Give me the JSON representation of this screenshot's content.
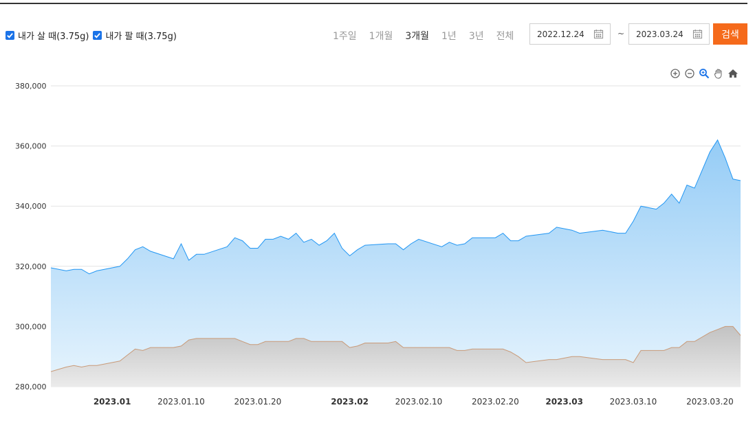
{
  "legend": {
    "buy_label": "내가 살 때(3.75g)",
    "sell_label": "내가 팔 때(3.75g)"
  },
  "periods": [
    {
      "label": "1주일",
      "active": false
    },
    {
      "label": "1개월",
      "active": false
    },
    {
      "label": "3개월",
      "active": true
    },
    {
      "label": "1년",
      "active": false
    },
    {
      "label": "3년",
      "active": false
    },
    {
      "label": "전체",
      "active": false
    }
  ],
  "date_range": {
    "start": "2022.12.24",
    "separator": "~",
    "end": "2023.03.24"
  },
  "search_label": "검색",
  "icons": [
    "zoom-in-icon",
    "zoom-out-icon",
    "selection-zoom-icon",
    "pan-hand-icon",
    "reset-home-icon"
  ],
  "colors": {
    "buy_line": "#2196f3",
    "buy_fill": "#a9d6f9",
    "sell_line": "#c99a78",
    "sell_fill": "#cfcfcf",
    "search_button": "#f56a1b",
    "checkbox": "#1a73e8"
  },
  "chart_data": {
    "type": "area",
    "x": [
      "2022.12.24",
      "2022.12.26",
      "2022.12.27",
      "2022.12.28",
      "2022.12.29",
      "2022.12.30",
      "2023.01.02",
      "2023.01.03",
      "2023.01.04",
      "2023.01.05",
      "2023.01.06",
      "2023.01.09",
      "2023.01.10",
      "2023.01.11",
      "2023.01.12",
      "2023.01.13",
      "2023.01.16",
      "2023.01.17",
      "2023.01.18",
      "2023.01.19",
      "2023.01.20",
      "2023.01.21",
      "2023.01.22",
      "2023.01.23",
      "2023.01.24",
      "2023.01.25",
      "2023.01.26",
      "2023.01.27",
      "2023.01.28",
      "2023.01.29",
      "2023.01.30",
      "2023.01.31",
      "2023.02.01",
      "2023.02.02",
      "2023.02.03",
      "2023.02.06",
      "2023.02.07",
      "2023.02.08",
      "2023.02.09",
      "2023.02.10",
      "2023.02.13",
      "2023.02.14",
      "2023.02.15",
      "2023.02.16",
      "2023.02.17",
      "2023.02.20",
      "2023.02.21",
      "2023.02.22",
      "2023.02.23",
      "2023.02.24",
      "2023.02.27",
      "2023.02.28",
      "2023.03.02",
      "2023.03.03",
      "2023.03.06",
      "2023.03.07",
      "2023.03.08",
      "2023.03.09",
      "2023.03.10",
      "2023.03.11",
      "2023.03.13",
      "2023.03.14",
      "2023.03.15",
      "2023.03.16",
      "2023.03.17",
      "2023.03.18",
      "2023.03.20",
      "2023.03.21",
      "2023.03.22",
      "2023.03.23",
      "2023.03.24"
    ],
    "series": [
      {
        "name": "내가 살 때(3.75g)",
        "values": [
          319500,
          318500,
          319000,
          319000,
          317500,
          318500,
          320000,
          322500,
          325500,
          326500,
          325000,
          322500,
          327500,
          322000,
          324000,
          324000,
          326500,
          329500,
          328500,
          326000,
          326000,
          329000,
          329000,
          330000,
          329000,
          331000,
          328000,
          329000,
          327000,
          328500,
          331000,
          326000,
          323500,
          325500,
          327000,
          327500,
          327500,
          325500,
          327500,
          329000,
          326500,
          328000,
          327000,
          327500,
          329500,
          329500,
          331000,
          328500,
          328500,
          330000,
          331000,
          333000,
          332000,
          331000,
          332000,
          331500,
          331000,
          331000,
          335000,
          340000,
          339000,
          341000,
          344000,
          341000,
          347000,
          346000,
          358000,
          362000,
          356000,
          349000,
          348500
        ]
      },
      {
        "name": "내가 팔 때(3.75g)",
        "values": [
          285000,
          286500,
          287000,
          286500,
          287000,
          287000,
          288500,
          290500,
          292500,
          292000,
          293000,
          293000,
          293500,
          295500,
          296000,
          296000,
          296000,
          296000,
          295000,
          294000,
          294000,
          295000,
          295000,
          295000,
          295000,
          296000,
          296000,
          295000,
          295000,
          295000,
          295000,
          295000,
          293000,
          293500,
          294500,
          294500,
          295000,
          293000,
          293000,
          293000,
          293000,
          293000,
          292000,
          292000,
          292500,
          292500,
          292500,
          291500,
          290000,
          288000,
          289000,
          289000,
          290000,
          290000,
          289000,
          289000,
          289000,
          289000,
          288000,
          292000,
          292000,
          292000,
          293000,
          293000,
          295000,
          295000,
          298000,
          299000,
          300000,
          300000,
          297000
        ]
      }
    ],
    "ylim": [
      280000,
      380000
    ],
    "yticks": [
      "280,000",
      "300,000",
      "320,000",
      "340,000",
      "360,000",
      "380,000"
    ],
    "xticks": [
      {
        "label": "2023.01",
        "date": "2023.01.01",
        "bold": true
      },
      {
        "label": "2023.01.10",
        "date": "2023.01.10",
        "bold": false
      },
      {
        "label": "2023.01.20",
        "date": "2023.01.20",
        "bold": false
      },
      {
        "label": "2023.02",
        "date": "2023.02.01",
        "bold": true
      },
      {
        "label": "2023.02.10",
        "date": "2023.02.10",
        "bold": false
      },
      {
        "label": "2023.02.20",
        "date": "2023.02.20",
        "bold": false
      },
      {
        "label": "2023.03",
        "date": "2023.03.01",
        "bold": true
      },
      {
        "label": "2023.03.10",
        "date": "2023.03.10",
        "bold": false
      },
      {
        "label": "2023.03.20",
        "date": "2023.03.20",
        "bold": false
      }
    ],
    "grid": true,
    "legend_position": "top-left"
  }
}
